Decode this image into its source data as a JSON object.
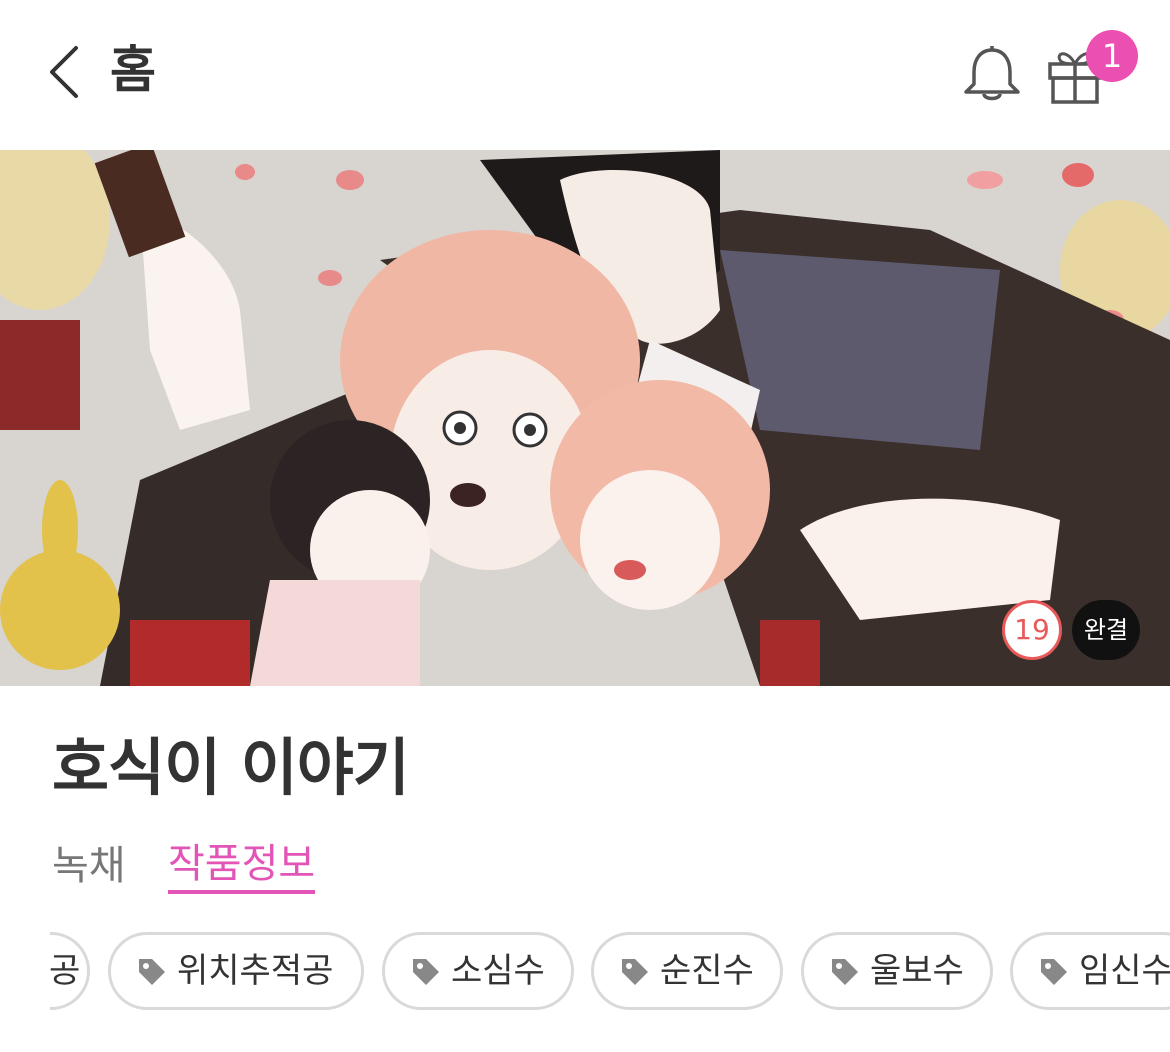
{
  "header": {
    "title": "홈",
    "gift_badge_count": "1",
    "icons": [
      "chevron-left-icon",
      "bell-icon",
      "gift-icon"
    ]
  },
  "banner": {
    "age_rating": "19",
    "status": "완결"
  },
  "series": {
    "title": "호식이 이야기",
    "author": "녹채",
    "info_tab": "작품정보"
  },
  "tags": {
    "partial_label": "공",
    "items": [
      "위치추적공",
      "소심수",
      "순진수",
      "울보수",
      "임신수"
    ]
  },
  "colors": {
    "accent": "#e255b6",
    "badge": "#ec4fb2",
    "age_badge": "#e85a5a",
    "text": "#333333"
  }
}
